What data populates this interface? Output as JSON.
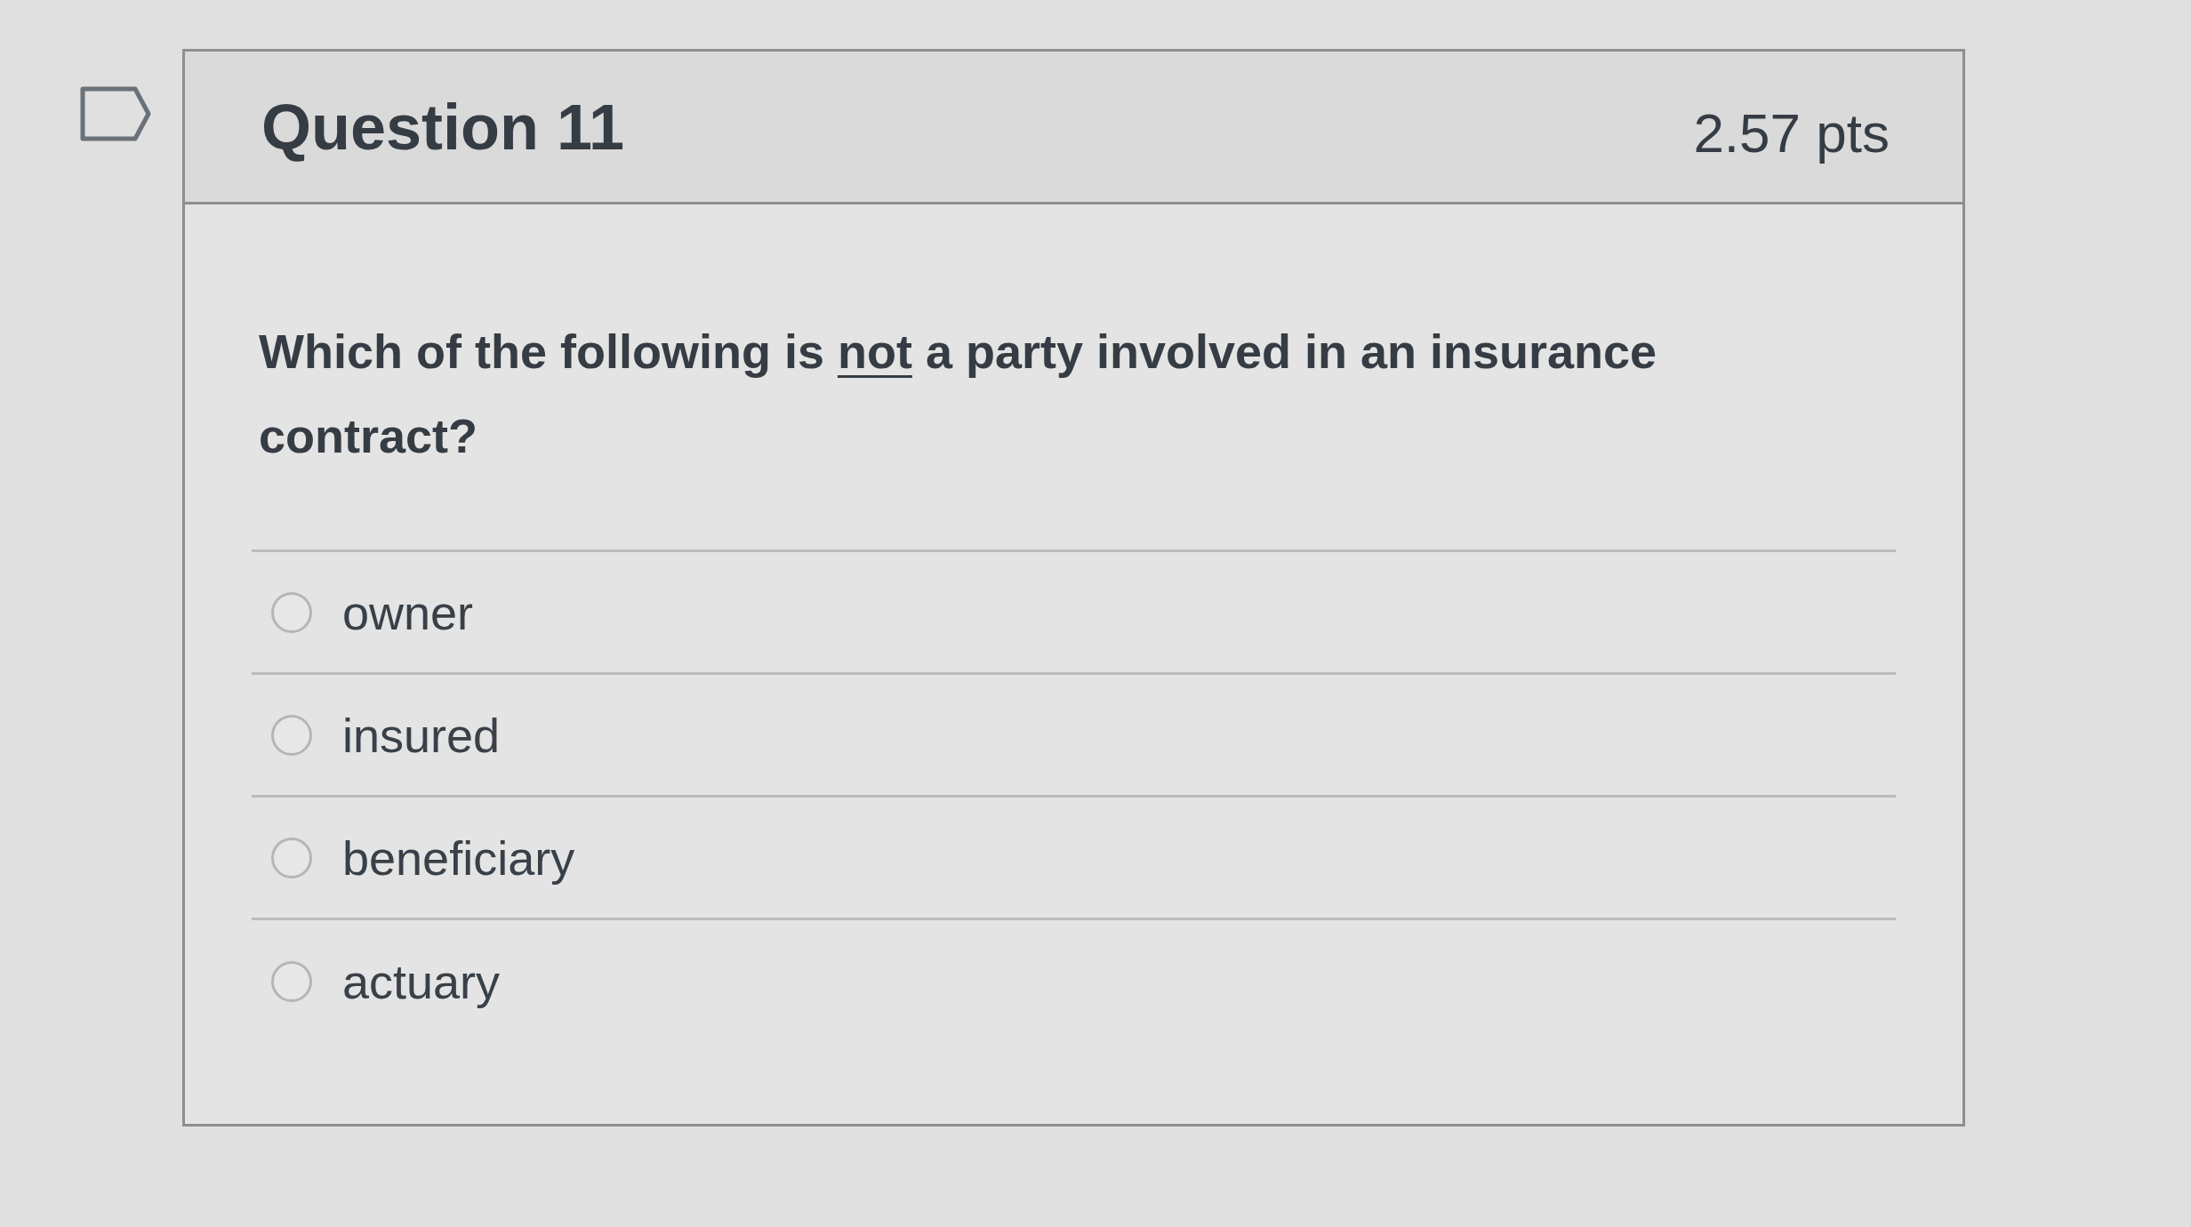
{
  "flag": {
    "flagged": false
  },
  "question": {
    "title": "Question 11",
    "points": "2.57 pts",
    "prompt": [
      {
        "text": "Which of the following is ",
        "underline": false
      },
      {
        "text": "not",
        "underline": true
      },
      {
        "text": " a party involved in an insurance contract?",
        "underline": false
      }
    ],
    "options": [
      {
        "label": "owner",
        "selected": false
      },
      {
        "label": "insured",
        "selected": false
      },
      {
        "label": "beneficiary",
        "selected": false
      },
      {
        "label": "actuary",
        "selected": false
      }
    ]
  }
}
